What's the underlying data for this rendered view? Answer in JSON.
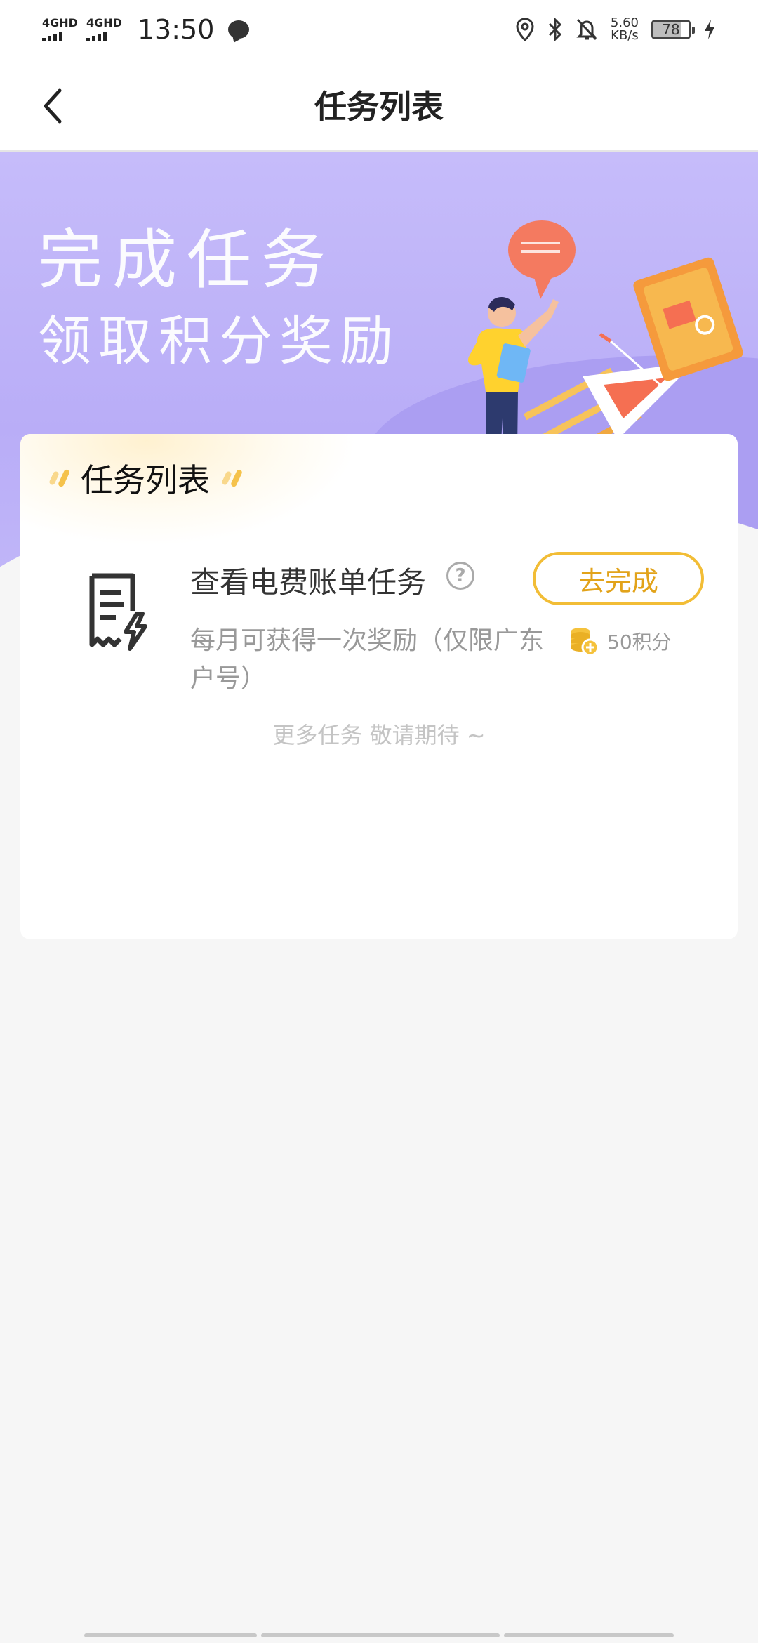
{
  "status_bar": {
    "network1": "4GHD",
    "network2": "4GHD",
    "time": "13:50",
    "speed_value": "5.60",
    "speed_unit": "KB/s",
    "battery": "78"
  },
  "header": {
    "title": "任务列表"
  },
  "banner": {
    "line1": "完成任务",
    "line2": "领取积分奖励"
  },
  "card": {
    "title": "任务列表",
    "task": {
      "name": "查看电费账单任务",
      "button": "去完成",
      "description": "每月可获得一次奖励（仅限广东户号）",
      "reward": "50积分"
    },
    "more": "更多任务 敬请期待 ~"
  },
  "colors": {
    "accent": "#f2bd36",
    "banner": "#c6bcfa",
    "background": "#f6f6f6"
  }
}
